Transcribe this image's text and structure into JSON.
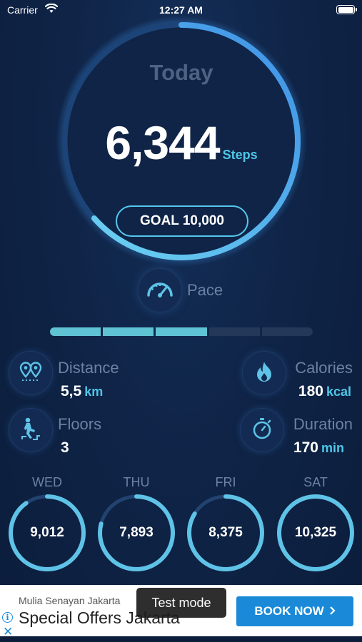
{
  "status_bar": {
    "carrier": "Carrier",
    "time": "12:27 AM"
  },
  "today": {
    "title": "Today",
    "steps": "6,344",
    "steps_unit": "Steps",
    "goal_label": "GOAL 10,000",
    "progress": 0.6344
  },
  "pace": {
    "label": "Pace",
    "segments_total": 5,
    "segments_filled": 3
  },
  "stats": {
    "distance": {
      "label": "Distance",
      "value": "5,5",
      "unit": "km",
      "icon": "map-pins-icon"
    },
    "calories": {
      "label": "Calories",
      "value": "180",
      "unit": "kcal",
      "icon": "flame-icon"
    },
    "floors": {
      "label": "Floors",
      "value": "3",
      "icon": "stairs-climber-icon"
    },
    "duration": {
      "label": "Duration",
      "value": "170",
      "unit": "min",
      "icon": "stopwatch-icon"
    }
  },
  "days": [
    {
      "label": "WED",
      "value": "9,012",
      "progress": 0.9012
    },
    {
      "label": "THU",
      "value": "7,893",
      "progress": 0.7893
    },
    {
      "label": "FRI",
      "value": "8,375",
      "progress": 0.8375
    },
    {
      "label": "SAT",
      "value": "10,325",
      "progress": 1.0
    }
  ],
  "ad": {
    "venue": "Mulia Senayan Jakarta",
    "title": "Special Offers Jakarta",
    "button": "BOOK NOW",
    "toast": "Test mode"
  },
  "colors": {
    "accent": "#4ec7e8",
    "ring": "#56b8ee",
    "track": "#1f3a66",
    "pace_fill": "#5fc3d4"
  }
}
